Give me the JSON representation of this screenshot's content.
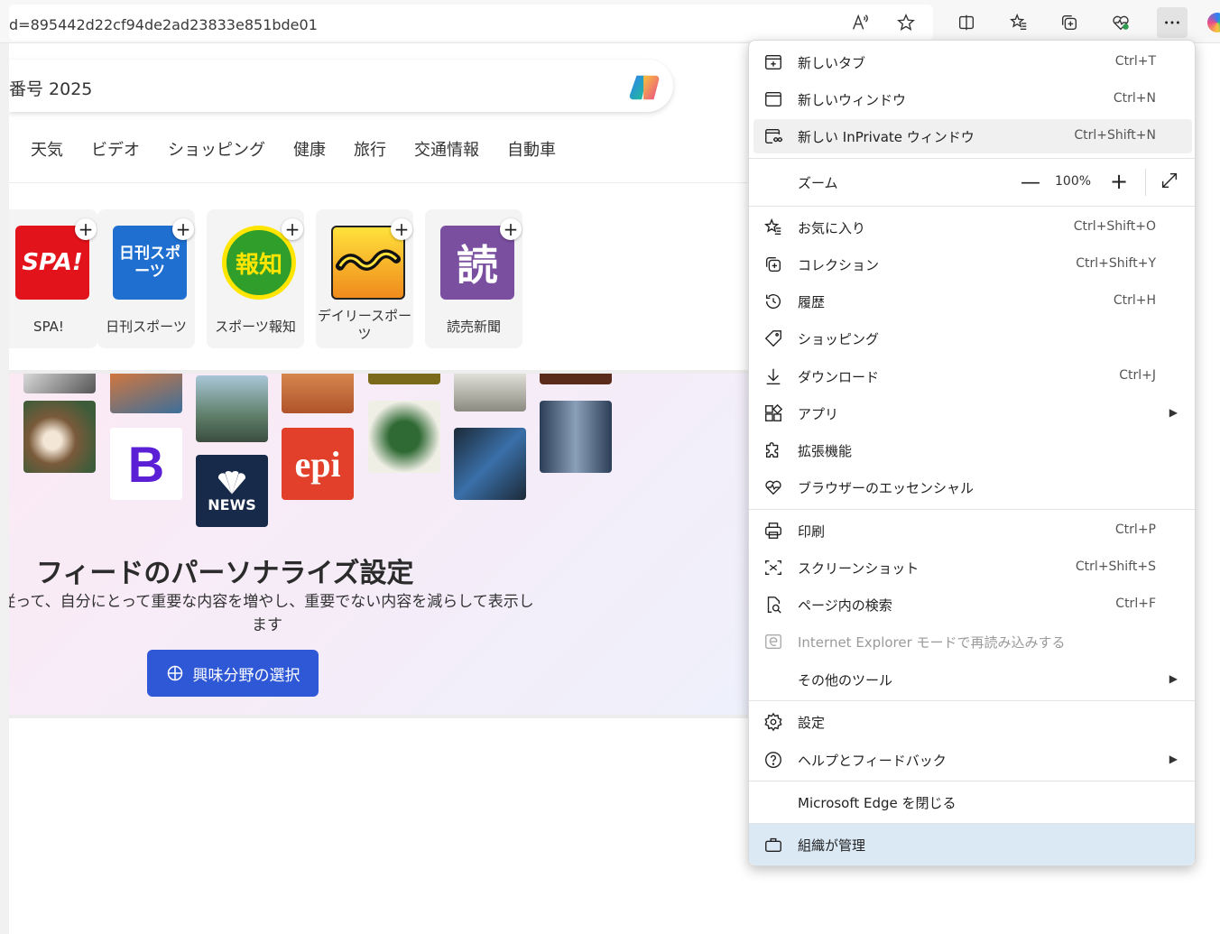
{
  "browser": {
    "address_text": "d=895442d22cf94de2ad23833e851bde01",
    "icons": [
      "read-aloud-icon",
      "favorite-star-icon",
      "split-screen-icon",
      "favorites-icon",
      "collections-icon",
      "browser-essentials-icon",
      "more-icon",
      "copilot-icon"
    ]
  },
  "page": {
    "search_text": "番号 2025",
    "nav_items": [
      "天気",
      "ビデオ",
      "ショッピング",
      "健康",
      "旅行",
      "交通情報",
      "自動車"
    ],
    "tiles": [
      {
        "label": "SPA!",
        "logo_text": "SPA!",
        "color": "#e3131b"
      },
      {
        "label": "日刊スポーツ",
        "logo_text": "日刊スポーツ",
        "color": "#1e6fd0"
      },
      {
        "label": "スポーツ報知",
        "logo_text": "報知",
        "color": "#2f9e2a"
      },
      {
        "label": "デイリースポーツ",
        "logo_text": "",
        "color": "#f9c21a"
      },
      {
        "label": "読売新聞",
        "logo_text": "読",
        "color": "#7a4fa0"
      }
    ],
    "feed": {
      "title": "フィードのパーソナライズ設定",
      "description": "従って、自分にとって重要な内容を増やし、重要でない内容を減らして表示します",
      "button_label": "興味分野の選択",
      "badges": [
        "B",
        "NEWS",
        "epi"
      ]
    }
  },
  "menu": {
    "items": [
      {
        "key": "new_tab",
        "label": "新しいタブ",
        "shortcut": "Ctrl+T"
      },
      {
        "key": "new_window",
        "label": "新しいウィンドウ",
        "shortcut": "Ctrl+N"
      },
      {
        "key": "new_inprivate",
        "label": "新しい InPrivate ウィンドウ",
        "shortcut": "Ctrl+Shift+N"
      },
      {
        "key": "favorites",
        "label": "お気に入り",
        "shortcut": "Ctrl+Shift+O"
      },
      {
        "key": "collections",
        "label": "コレクション",
        "shortcut": "Ctrl+Shift+Y"
      },
      {
        "key": "history",
        "label": "履歴",
        "shortcut": "Ctrl+H"
      },
      {
        "key": "shopping",
        "label": "ショッピング",
        "shortcut": ""
      },
      {
        "key": "downloads",
        "label": "ダウンロード",
        "shortcut": "Ctrl+J"
      },
      {
        "key": "apps",
        "label": "アプリ",
        "shortcut": ""
      },
      {
        "key": "extensions",
        "label": "拡張機能",
        "shortcut": ""
      },
      {
        "key": "essentials",
        "label": "ブラウザーのエッセンシャル",
        "shortcut": ""
      },
      {
        "key": "print",
        "label": "印刷",
        "shortcut": "Ctrl+P"
      },
      {
        "key": "screenshot",
        "label": "スクリーンショット",
        "shortcut": "Ctrl+Shift+S"
      },
      {
        "key": "find",
        "label": "ページ内の検索",
        "shortcut": "Ctrl+F"
      },
      {
        "key": "ie_mode",
        "label": "Internet Explorer モードで再読み込みする",
        "shortcut": ""
      },
      {
        "key": "more_tools",
        "label": "その他のツール",
        "shortcut": ""
      },
      {
        "key": "settings",
        "label": "設定",
        "shortcut": ""
      },
      {
        "key": "help",
        "label": "ヘルプとフィードバック",
        "shortcut": ""
      },
      {
        "key": "close_edge",
        "label": "Microsoft Edge を閉じる",
        "shortcut": ""
      },
      {
        "key": "managed",
        "label": "組織が管理",
        "shortcut": ""
      }
    ],
    "zoom": {
      "label": "ズーム",
      "value": "100%",
      "minus": "—",
      "plus": "+"
    },
    "arrow_glyph": "▶"
  },
  "colors": {
    "accent_button": "#2f58d6",
    "menu_highlight": "#f0f0f0",
    "managed_bg": "#dbe9f5"
  }
}
